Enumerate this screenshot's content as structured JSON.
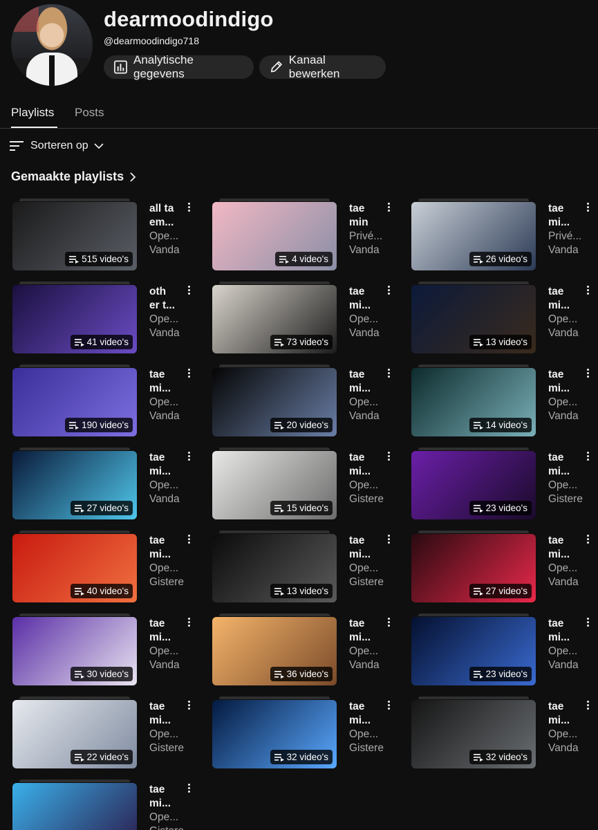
{
  "channel": {
    "name": "dearmoodindigo",
    "handle": "@dearmoodindigo718",
    "analytics_label": "Analytische gegevens",
    "edit_label": "Kanaal bewerken"
  },
  "tabs": [
    {
      "label": "Playlists",
      "active": true
    },
    {
      "label": "Posts",
      "active": false
    }
  ],
  "sort_label": "Sorteren op",
  "section_title": "Gemaakte playlists",
  "playlists": [
    {
      "title": [
        "all ta",
        "em..."
      ],
      "status": "Ope...",
      "updated": "Vanda",
      "count": "515 video's"
    },
    {
      "title": [
        "tae",
        "min"
      ],
      "status": "Privé...",
      "updated": "Vanda",
      "count": "4 video's"
    },
    {
      "title": [
        "tae",
        "mi..."
      ],
      "status": "Privé...",
      "updated": "Vanda",
      "count": "26 video's"
    },
    {
      "title": [
        "oth",
        "er t..."
      ],
      "status": "Ope...",
      "updated": "Vanda",
      "count": "41 video's"
    },
    {
      "title": [
        "tae",
        "mi..."
      ],
      "status": "Ope...",
      "updated": "Vanda",
      "count": "73 video's"
    },
    {
      "title": [
        "tae",
        "mi..."
      ],
      "status": "Ope...",
      "updated": "Vanda",
      "count": "13 video's"
    },
    {
      "title": [
        "tae",
        "mi..."
      ],
      "status": "Ope...",
      "updated": "Vanda",
      "count": "190 video's"
    },
    {
      "title": [
        "tae",
        "mi..."
      ],
      "status": "Ope...",
      "updated": "Vanda",
      "count": "20 video's"
    },
    {
      "title": [
        "tae",
        "mi..."
      ],
      "status": "Ope...",
      "updated": "Vanda",
      "count": "14 video's"
    },
    {
      "title": [
        "tae",
        "mi..."
      ],
      "status": "Ope...",
      "updated": "Vanda",
      "count": "27 video's"
    },
    {
      "title": [
        "tae",
        "mi..."
      ],
      "status": "Ope...",
      "updated": "Gistere",
      "count": "15 video's"
    },
    {
      "title": [
        "tae",
        "mi..."
      ],
      "status": "Ope...",
      "updated": "Gistere",
      "count": "23 video's"
    },
    {
      "title": [
        "tae",
        "mi..."
      ],
      "status": "Ope...",
      "updated": "Gistere",
      "count": "40 video's"
    },
    {
      "title": [
        "tae",
        "mi..."
      ],
      "status": "Ope...",
      "updated": "Gistere",
      "count": "13 video's"
    },
    {
      "title": [
        "tae",
        "mi..."
      ],
      "status": "Ope...",
      "updated": "Vanda",
      "count": "27 video's"
    },
    {
      "title": [
        "tae",
        "mi..."
      ],
      "status": "Ope...",
      "updated": "Vanda",
      "count": "30 video's"
    },
    {
      "title": [
        "tae",
        "mi..."
      ],
      "status": "Ope...",
      "updated": "Vanda",
      "count": "36 video's"
    },
    {
      "title": [
        "tae",
        "mi..."
      ],
      "status": "Ope...",
      "updated": "Vanda",
      "count": "23 video's"
    },
    {
      "title": [
        "tae",
        "mi..."
      ],
      "status": "Ope...",
      "updated": "Gistere",
      "count": "22 video's"
    },
    {
      "title": [
        "tae",
        "mi..."
      ],
      "status": "Ope...",
      "updated": "Gistere",
      "count": "32 video's"
    },
    {
      "title": [
        "tae",
        "mi..."
      ],
      "status": "Ope...",
      "updated": "Vanda",
      "count": "32 video's"
    },
    {
      "title": [
        "tae",
        "mi..."
      ],
      "status": "Ope...",
      "updated": "Gistere",
      "count": null
    }
  ],
  "thumb_colors": [
    [
      "#1a1a1a",
      "#5a5e66"
    ],
    [
      "#f2b8c4",
      "#8a8ea6"
    ],
    [
      "#c9cfd6",
      "#2b3a55"
    ],
    [
      "#1b1040",
      "#6a4cc4"
    ],
    [
      "#d9d4cc",
      "#1c1c1c"
    ],
    [
      "#0c1a3a",
      "#3a2a1c"
    ],
    [
      "#3a2f9a",
      "#7d6fe0"
    ],
    [
      "#050505",
      "#6a7fa6"
    ],
    [
      "#0d2b2d",
      "#7ab0b8"
    ],
    [
      "#0a1a3a",
      "#4fc6ea"
    ],
    [
      "#e8e8e6",
      "#6b6b6b"
    ],
    [
      "#6b1fa8",
      "#1a0a2a"
    ],
    [
      "#c81a10",
      "#f07040"
    ],
    [
      "#0b0b0b",
      "#5a5a5a"
    ],
    [
      "#2a0a10",
      "#e8284a"
    ],
    [
      "#5a2fa6",
      "#e9e3f0"
    ],
    [
      "#f4b46a",
      "#7a4a2a"
    ],
    [
      "#041030",
      "#3a6ad0"
    ],
    [
      "#e6e9ee",
      "#7f8ba0"
    ],
    [
      "#041a40",
      "#5aa8ff"
    ],
    [
      "#151515",
      "#6a6e72"
    ],
    [
      "#3ab0ea",
      "#2a1a4a"
    ]
  ]
}
